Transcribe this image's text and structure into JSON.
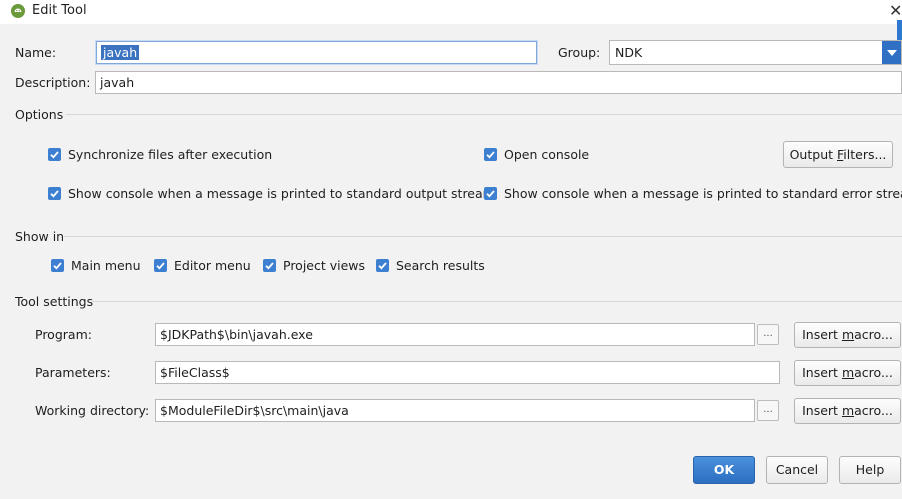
{
  "window": {
    "title": "Edit Tool",
    "close_glyph": "✕"
  },
  "name": {
    "label": "Name:",
    "value": "javah"
  },
  "group": {
    "label": "Group:",
    "value": "NDK"
  },
  "description": {
    "label": "Description:",
    "value": "javah"
  },
  "options": {
    "heading": "Options",
    "sync_files": {
      "label": "Synchronize files after execution",
      "checked": true
    },
    "open_console": {
      "label": "Open console",
      "checked": true
    },
    "output_filters_button": {
      "pre": "Output ",
      "u": "F",
      "post": "ilters..."
    },
    "show_console_stdout": {
      "label": "Show console when a message is printed to standard output stream",
      "checked": true
    },
    "show_console_stderr": {
      "label": "Show console when a message is printed to standard error stream",
      "checked": true
    }
  },
  "show_in": {
    "heading": "Show in",
    "items": [
      {
        "label": "Main menu",
        "checked": true
      },
      {
        "label": "Editor menu",
        "checked": true
      },
      {
        "label": "Project views",
        "checked": true
      },
      {
        "label": "Search results",
        "checked": true
      }
    ]
  },
  "tool_settings": {
    "heading": "Tool settings",
    "program": {
      "label": "Program:",
      "value": "$JDKPath$\\bin\\javah.exe"
    },
    "parameters": {
      "label": "Parameters:",
      "value": "$FileClass$"
    },
    "working_directory": {
      "label": "Working directory:",
      "value": "$ModuleFileDir$\\src\\main\\java"
    },
    "browse_label": "...",
    "insert_macro": {
      "pre": "Insert ",
      "u": "m",
      "post": "acro..."
    }
  },
  "footer": {
    "ok_label": "OK",
    "cancel_label": "Cancel",
    "help_label": "Help"
  },
  "colors": {
    "accent": "#2f6fc4",
    "checkbox": "#3d7fd1",
    "background": "#f2f2f2"
  },
  "icons": {
    "app": "android-icon",
    "checkbox": "checkmark-icon",
    "dropdown": "chevron-down-icon"
  }
}
